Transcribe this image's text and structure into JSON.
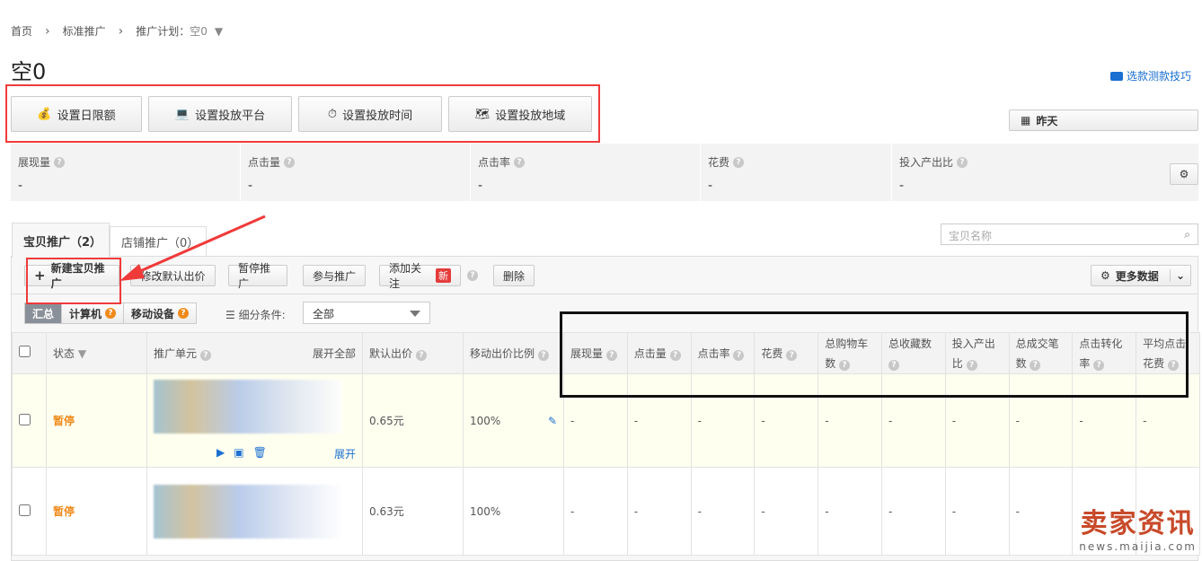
{
  "breadcrumb": {
    "home": "首页",
    "level2": "标准推广",
    "plan_label": "推广计划：",
    "plan_value": "空0"
  },
  "title": "空0",
  "tip_link": "选款测款技巧",
  "settings_buttons": [
    {
      "label": "设置日限额",
      "icon": "money-bag-icon"
    },
    {
      "label": "设置投放平台",
      "icon": "laptop-icon"
    },
    {
      "label": "设置投放时间",
      "icon": "stopwatch-icon"
    },
    {
      "label": "设置投放地域",
      "icon": "map-icon"
    }
  ],
  "date_button": "昨天",
  "stats": [
    {
      "label": "展现量",
      "value": "-"
    },
    {
      "label": "点击量",
      "value": "-"
    },
    {
      "label": "点击率",
      "value": "-"
    },
    {
      "label": "花费",
      "value": "-"
    },
    {
      "label": "投入产出比",
      "value": "-"
    }
  ],
  "tabs": [
    {
      "label": "宝贝推广（2）"
    },
    {
      "label": "店铺推广（0）"
    }
  ],
  "search_placeholder": "宝贝名称",
  "toolbar": {
    "new": "新建宝贝推广",
    "edit_price": "修改默认出价",
    "pause": "暂停推广",
    "join": "参与推广",
    "follow": "添加关注",
    "new_badge": "新",
    "delete": "删除",
    "more_data": "更多数据"
  },
  "segments": {
    "summary": "汇总",
    "pc": "计算机",
    "mobile": "移动设备",
    "filter_label": "细分条件:",
    "filter_value": "全部"
  },
  "table": {
    "headers": {
      "status": "状态",
      "unit": "推广单元",
      "expand_all": "展开全部",
      "price": "默认出价",
      "mobile_ratio": "移动出价比例"
    },
    "metric_headers": [
      "展现量",
      "点击量",
      "点击率",
      "花费",
      "总购物车数",
      "总收藏数",
      "投入产出比",
      "总成交笔数",
      "点击转化率",
      "平均点击花费"
    ],
    "rows": [
      {
        "status": "暂停",
        "price": "0.65元",
        "mobile_ratio": "100%",
        "expand": "展开",
        "metrics": [
          "-",
          "-",
          "-",
          "-",
          "-",
          "-",
          "-",
          "-",
          "-",
          "-"
        ]
      },
      {
        "status": "暂停",
        "price": "0.63元",
        "mobile_ratio": "100%",
        "metrics": [
          "-",
          "-",
          "-",
          "-",
          "-",
          "-",
          "-",
          "-",
          "",
          ""
        ]
      }
    ]
  },
  "watermark": {
    "main": "卖家资讯",
    "sub": "news.maijia.com"
  },
  "colors": {
    "accent": "#1a6fd1",
    "paused": "#f08a1a",
    "annotation_red": "#f03a3a"
  }
}
